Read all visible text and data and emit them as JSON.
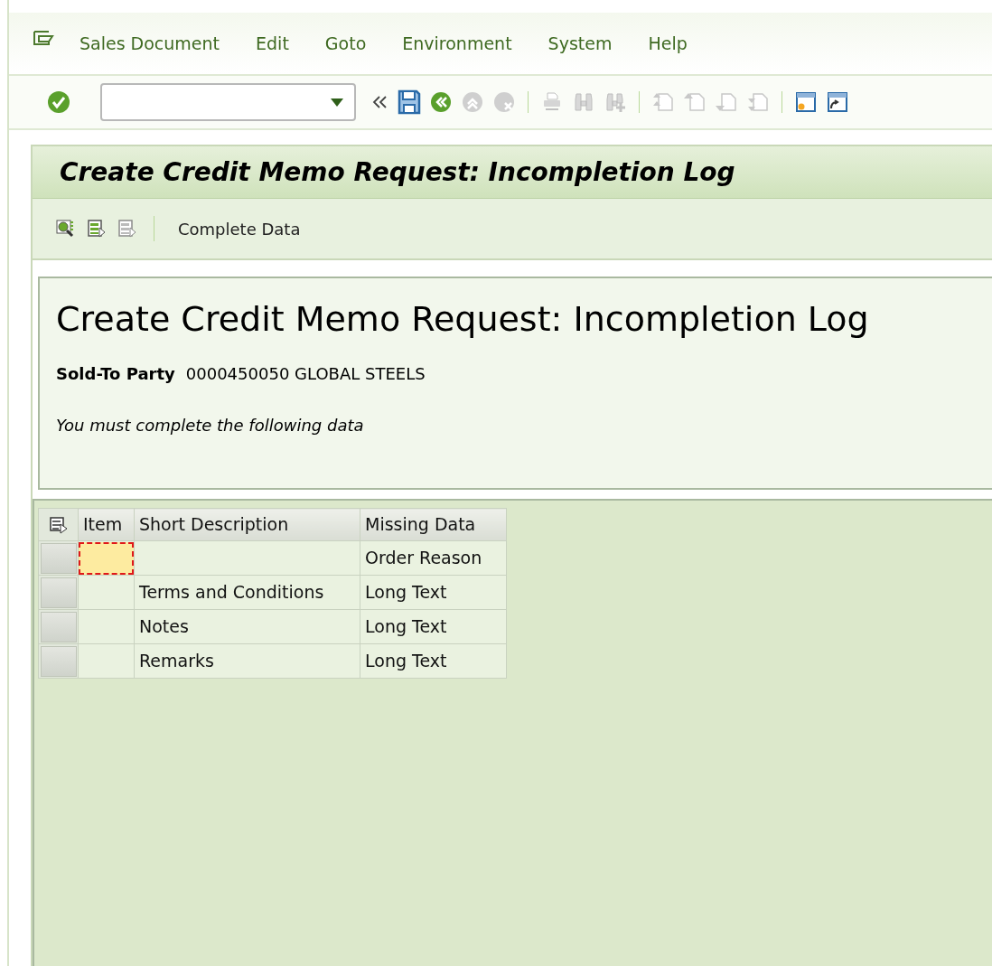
{
  "menu_bar": {
    "items": [
      "Sales Document",
      "Edit",
      "Goto",
      "Environment",
      "System",
      "Help"
    ]
  },
  "system_toolbar": {
    "buttons": [
      {
        "kind": "back",
        "disabled": false
      },
      {
        "kind": "exit",
        "disabled": true
      },
      {
        "kind": "cancel",
        "disabled": true
      },
      {
        "kind": "sep"
      },
      {
        "kind": "print",
        "disabled": true
      },
      {
        "kind": "find",
        "disabled": true
      },
      {
        "kind": "find-next",
        "disabled": true
      },
      {
        "kind": "sep"
      },
      {
        "kind": "first-page",
        "disabled": true
      },
      {
        "kind": "prev-page",
        "disabled": true
      },
      {
        "kind": "next-page",
        "disabled": true
      },
      {
        "kind": "last-page",
        "disabled": true
      },
      {
        "kind": "sep"
      },
      {
        "kind": "new-session",
        "disabled": false
      },
      {
        "kind": "shortcut",
        "disabled": false
      }
    ]
  },
  "title_bar": {
    "title": "Create Credit Memo Request: Incompletion Log"
  },
  "application_toolbar": {
    "icons": [
      {
        "kind": "inspect"
      },
      {
        "kind": "select-all"
      },
      {
        "kind": "deselect-all"
      }
    ],
    "buttons": [
      "Complete Data"
    ]
  },
  "header": {
    "title": "Create Credit Memo Request: Incompletion Log",
    "sold_to_label": "Sold-To Party",
    "sold_to_value": "0000450050 GLOBAL STEELS",
    "message": "You must complete the following data"
  },
  "table": {
    "columns": [
      "Item",
      "Short Description",
      "Missing Data"
    ],
    "rows": [
      {
        "focused": true,
        "short_description": "",
        "missing_data": "Order Reason"
      },
      {
        "focused": false,
        "short_description": "Terms and Conditions",
        "missing_data": "Long Text"
      },
      {
        "focused": false,
        "short_description": "Notes",
        "missing_data": "Long Text"
      },
      {
        "focused": false,
        "short_description": "Remarks",
        "missing_data": "Long Text"
      }
    ]
  }
}
